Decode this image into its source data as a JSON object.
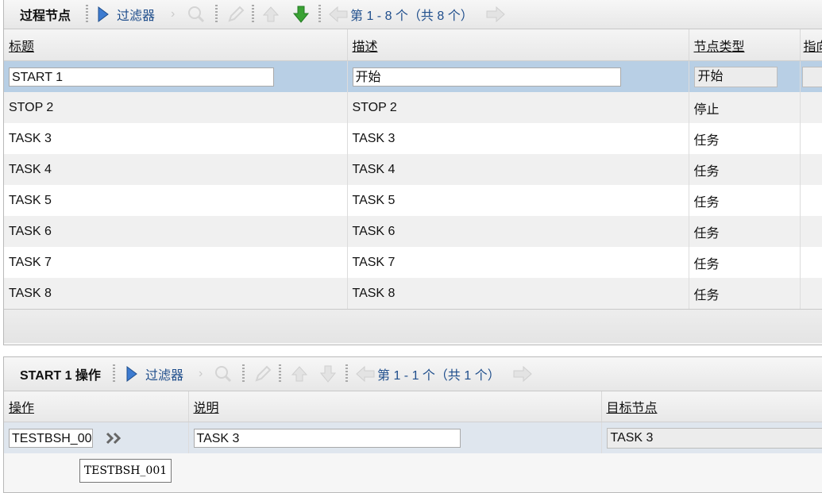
{
  "top_panel": {
    "title": "过程节点",
    "filter_label": "过滤器",
    "pager": "第 1 - 8 个（共 8 个）",
    "columns": [
      "标题",
      "描述",
      "节点类型",
      "指向"
    ],
    "rows": [
      {
        "title": "START 1",
        "desc": "开始",
        "type": "开始"
      },
      {
        "title": "STOP 2",
        "desc": "STOP 2",
        "type": "停止"
      },
      {
        "title": "TASK 3",
        "desc": "TASK 3",
        "type": "任务"
      },
      {
        "title": "TASK 4",
        "desc": "TASK 4",
        "type": "任务"
      },
      {
        "title": "TASK 5",
        "desc": "TASK 5",
        "type": "任务"
      },
      {
        "title": "TASK 6",
        "desc": "TASK 6",
        "type": "任务"
      },
      {
        "title": "TASK 7",
        "desc": "TASK 7",
        "type": "任务"
      },
      {
        "title": "TASK 8",
        "desc": "TASK 8",
        "type": "任务"
      }
    ]
  },
  "bottom_panel": {
    "title": "START 1 操作",
    "filter_label": "过滤器",
    "pager": "第 1 - 1 个（共 1 个）",
    "columns": [
      "操作",
      "说明",
      "目标节点"
    ],
    "row": {
      "action": "TESTBSH_001",
      "desc": "TASK 3",
      "target": "TASK 3"
    }
  },
  "tooltip": "TESTBSH_001",
  "icons": {
    "filter_arrow": "play-triangle-icon",
    "down_arrow_color": "#3aa234"
  }
}
